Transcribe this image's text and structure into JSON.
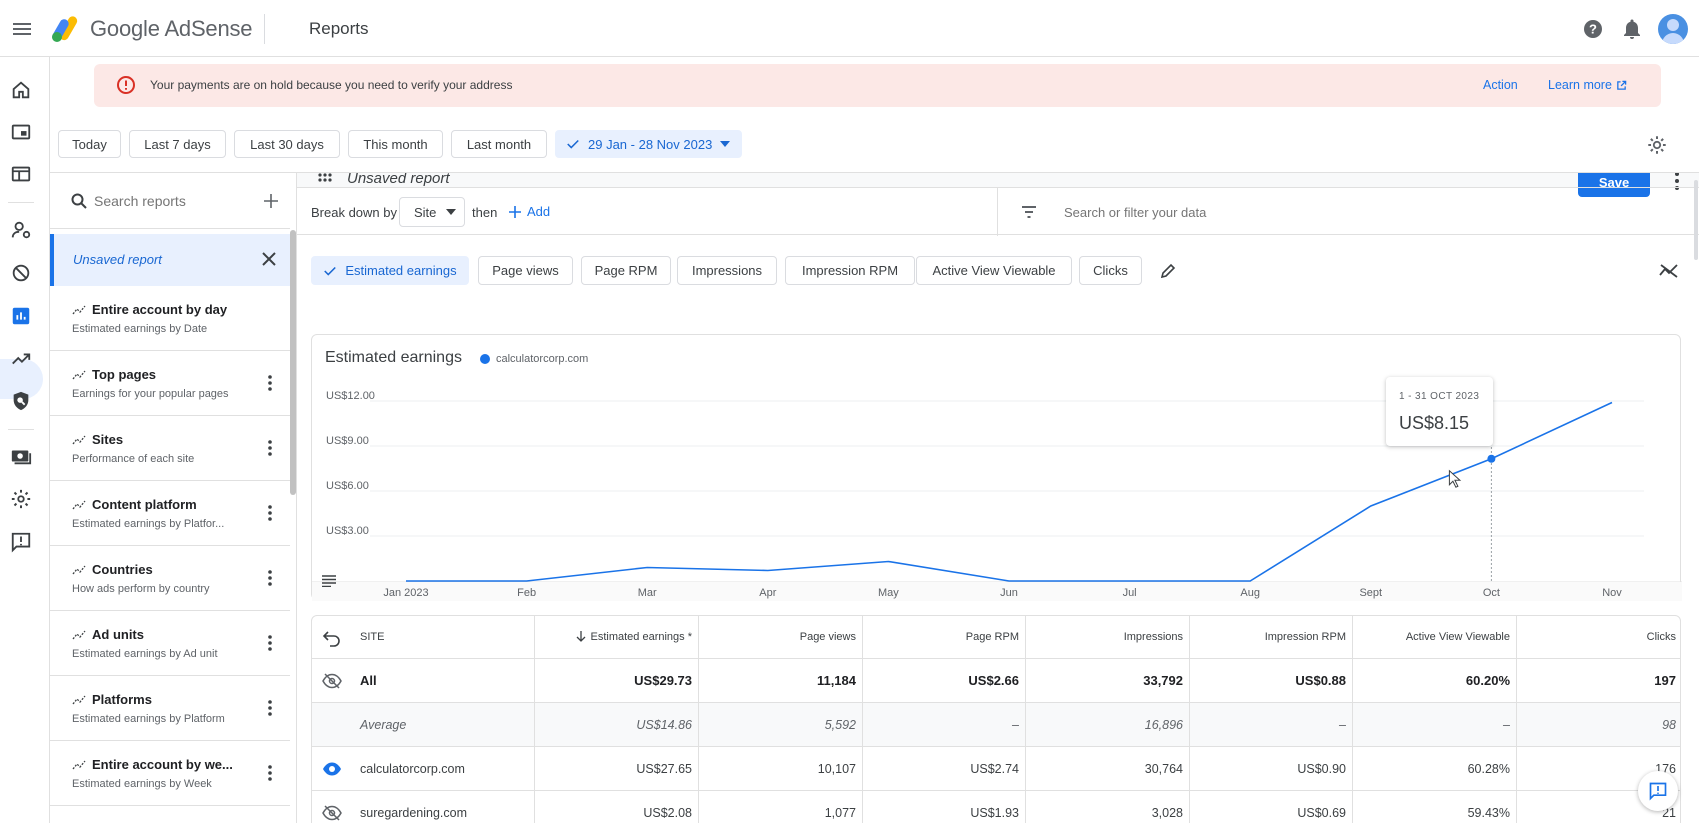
{
  "app": {
    "brand_google": "Google",
    "brand_adsense": "AdSense",
    "page_title": "Reports"
  },
  "icons": {
    "menu": "hamburger-menu-icon",
    "logo": "adsense-logo",
    "help": "help-icon",
    "notifications": "bell-icon",
    "avatar": "account-avatar"
  },
  "rail": {
    "items": [
      "home",
      "ads",
      "sites",
      "privacy-messaging",
      "blocking-controls",
      "reports",
      "optimization",
      "policy-center",
      "payments",
      "account",
      "feedback"
    ],
    "active": "reports"
  },
  "alert": {
    "text": "Your payments are on hold because you need to verify your address",
    "action": "Action",
    "learn_more": "Learn more"
  },
  "date_chips": [
    "Today",
    "Last 7 days",
    "Last 30 days",
    "This month",
    "Last month"
  ],
  "date_range": "29 Jan - 28 Nov 2023",
  "reports_panel": {
    "search_placeholder": "Search reports",
    "unsaved_label": "Unsaved report",
    "items": [
      {
        "title": "Entire account by day",
        "subtitle": "Estimated earnings by Date"
      },
      {
        "title": "Top pages",
        "subtitle": "Earnings for your popular pages"
      },
      {
        "title": "Sites",
        "subtitle": "Performance of each site"
      },
      {
        "title": "Content platform",
        "subtitle": "Estimated earnings by Platfor..."
      },
      {
        "title": "Countries",
        "subtitle": "How ads perform by country"
      },
      {
        "title": "Ad units",
        "subtitle": "Estimated earnings by Ad unit"
      },
      {
        "title": "Platforms",
        "subtitle": "Estimated earnings by Platform"
      },
      {
        "title": "Entire account by we...",
        "subtitle": "Estimated earnings by Week"
      }
    ]
  },
  "report": {
    "title": "Unsaved report",
    "save": "Save",
    "breakdown_label": "Break down by",
    "breakdown_value": "Site",
    "then": "then",
    "add": "Add",
    "filter_placeholder": "Search or filter your data"
  },
  "metrics": [
    "Estimated earnings",
    "Page views",
    "Page RPM",
    "Impressions",
    "Impression RPM",
    "Active View Viewable",
    "Clicks"
  ],
  "selected_metric": "Estimated earnings",
  "chart": {
    "title": "Estimated earnings",
    "legend": "calculatorcorp.com",
    "tooltip_period": "1 - 31 OCT 2023",
    "tooltip_value": "US$8.15"
  },
  "chart_data": {
    "type": "line",
    "title": "Estimated earnings",
    "categories": [
      "Jan 2023",
      "Feb",
      "Mar",
      "Apr",
      "May",
      "Jun",
      "Jul",
      "Aug",
      "Sept",
      "Oct",
      "Nov"
    ],
    "series": [
      {
        "name": "calculatorcorp.com",
        "values": [
          0,
          0,
          0.9,
          0.7,
          1.3,
          0,
          0,
          0,
          5.0,
          8.15,
          11.9
        ]
      }
    ],
    "yticks": [
      "US$3.00",
      "US$6.00",
      "US$9.00",
      "US$12.00"
    ],
    "ytick_values": [
      3,
      6,
      9,
      12
    ],
    "ylim": [
      0,
      12.8
    ],
    "grid": true,
    "color": "#1a73e8"
  },
  "table": {
    "headers": [
      "SITE",
      "Estimated earnings *",
      "Page views",
      "Page RPM",
      "Impressions",
      "Impression RPM",
      "Active View Viewable",
      "Clicks"
    ],
    "all": [
      "All",
      "US$29.73",
      "11,184",
      "US$2.66",
      "33,792",
      "US$0.88",
      "60.20%",
      "197"
    ],
    "average": [
      "Average",
      "US$14.86",
      "5,592",
      "–",
      "16,896",
      "–",
      "–",
      "98"
    ],
    "rows": [
      [
        "calculatorcorp.com",
        "US$27.65",
        "10,107",
        "US$2.74",
        "30,764",
        "US$0.90",
        "60.28%",
        "176"
      ],
      [
        "suregardening.com",
        "US$2.08",
        "1,077",
        "US$1.93",
        "3,028",
        "US$0.69",
        "59.43%",
        "21"
      ]
    ]
  },
  "colors": {
    "accent": "#1a73e8",
    "alert_bg": "#fce8e6",
    "alert_icon": "#d93025",
    "selected_bg": "#e8f0fe"
  }
}
